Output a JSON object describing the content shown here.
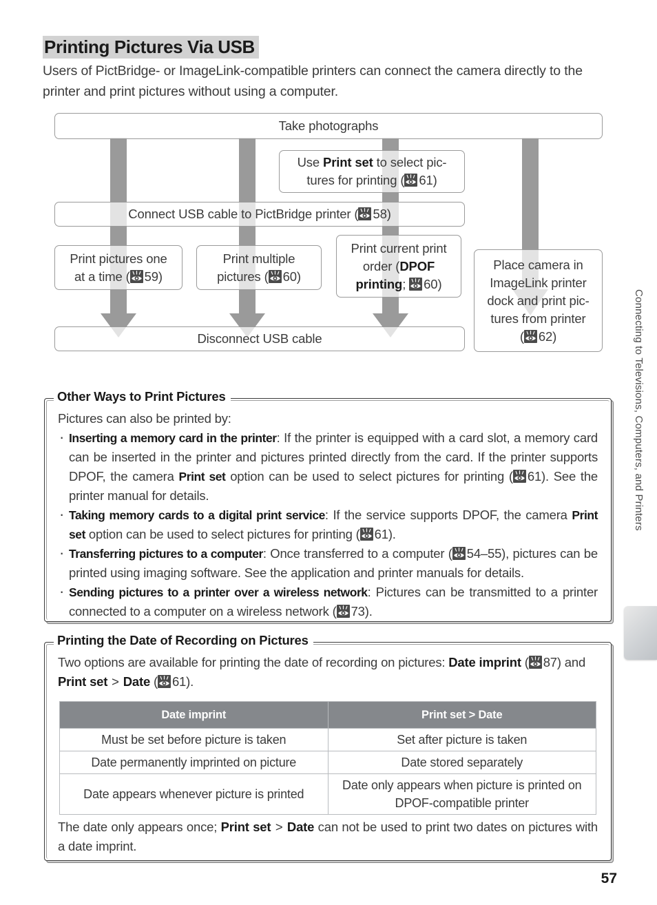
{
  "page": {
    "title": "Printing Pictures Via USB",
    "intro": "Users of PictBridge- or ImageLink-compatible printers can connect the camera directly to the printer and print pictures without using a computer.",
    "number": "57",
    "side_tab_text": "Connecting to Televisions, Computers, and Printers"
  },
  "colors": {
    "title_highlight": "#d2d2d2",
    "arrow": "#9a9a9a",
    "box_border": "#9a9a9a",
    "table_header_bg": "#85888c",
    "table_border": "#b8bbbe",
    "body_text": "#3b3b3b",
    "heading_text": "#1a1a1a",
    "side_tab": "#c9cdd1"
  },
  "flowchart": {
    "boxes": [
      {
        "id": "take-photographs",
        "text": "Take photographs"
      },
      {
        "id": "use-print-set",
        "text_html": "Use <b>Print set</b> to select pic-<br>tures for printing (■61)",
        "ref": "61"
      },
      {
        "id": "connect-usb-cable",
        "text_html": "Connect USB cable to PictBridge printer (■58)",
        "ref": "58"
      },
      {
        "id": "print-one-at-a-time",
        "text_html": "Print pictures one<br>at a time (■59)",
        "ref": "59"
      },
      {
        "id": "print-multiple",
        "text_html": "Print multiple<br>pictures (■60)",
        "ref": "60"
      },
      {
        "id": "print-current-order",
        "text_html": "Print current print<br>order (<b>DPOF</b><br><b>printing</b>; ■60)",
        "ref": "60"
      },
      {
        "id": "place-camera-imagelink",
        "text_html": "Place camera in<br>ImageLink printer<br>dock and print pic-<br>tures from printer<br>(■62)",
        "ref": "62"
      },
      {
        "id": "disconnect-usb-cable",
        "text": "Disconnect USB cable"
      }
    ]
  },
  "notes": [
    {
      "id": "other-ways",
      "title": "Other Ways to Print Pictures",
      "lead": "Pictures can also be printed by:",
      "bullets": [
        {
          "label": "Inserting a memory card in the printer",
          "body_html": ": If the printer is equipped with a card slot, a memory card can be inserted in the printer and pictures printed directly from the card.  If the printer supports DPOF, the camera <b>Print set</b> option can be used to select pictures for printing (■61).  See the printer manual for details."
        },
        {
          "label": "Taking memory cards to a digital print service",
          "body_html": ": If the service supports DPOF, the camera <b>Print set</b> option can be used to select pictures for printing (■61)."
        },
        {
          "label": "Transferring pictures to a computer",
          "body_html": ": Once transferred to a computer (■54–55), pictures can be printed using imaging software.  See the application and printer manuals for details."
        },
        {
          "label": "Sending pictures to a printer over a wireless network",
          "body_html": ": Pictures can be transmitted to a printer connected to a computer on a wireless network (■73)."
        }
      ]
    },
    {
      "id": "printing-date",
      "title": "Printing the Date of Recording on Pictures",
      "lead_html": "Two options are available for printing the date of recording on pictures: <b>Date imprint</b> (■87) and <b>Print set</b> <span class=\"gt\">&gt;</span> <b>Date</b> (■61).",
      "closing_html": "The date only appears once; <b>Print set</b> <span class=\"gt\">&gt;</span> <b>Date</b> can not be used to print two dates on pictures with a date imprint."
    }
  ],
  "table": {
    "headers": [
      "Date imprint",
      "Print set > Date"
    ],
    "rows": [
      [
        "Must be set before picture is taken",
        "Set after picture is taken"
      ],
      [
        "Date permanently imprinted on picture",
        "Date stored separately"
      ],
      [
        "Date appears whenever picture is printed",
        "Date only appears when picture is printed on DPOF-compatible printer"
      ]
    ]
  }
}
